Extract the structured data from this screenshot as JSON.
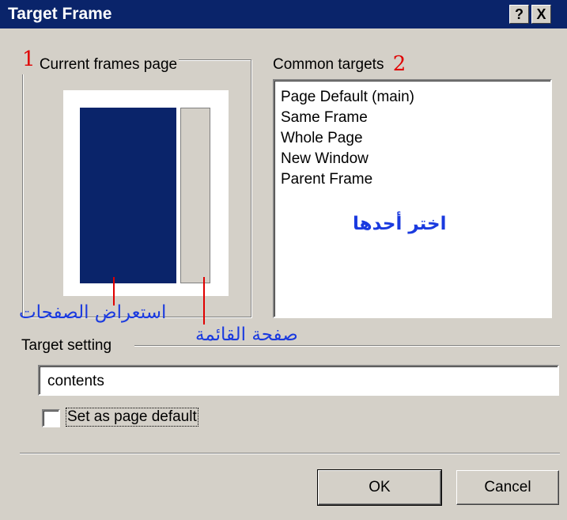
{
  "window": {
    "title": "Target Frame",
    "help_label": "?",
    "close_label": "X"
  },
  "current_frames": {
    "label": "Current frames page",
    "annotation_number": "1"
  },
  "common_targets": {
    "label": "Common targets",
    "annotation_number": "2",
    "items": [
      "Page Default (main)",
      "Same Frame",
      "Whole Page",
      "New Window",
      "Parent Frame"
    ],
    "annotation_text": "اختر أحدها"
  },
  "annotations": {
    "main_frame": "استعراض الصفحات",
    "side_frame": "صفحة القائمة"
  },
  "target_setting": {
    "label": "Target setting",
    "value": "contents"
  },
  "page_default": {
    "label": "Set as page default",
    "checked": false
  },
  "buttons": {
    "ok": "OK",
    "cancel": "Cancel"
  },
  "colors": {
    "titlebar": "#0a246a",
    "main_frame": "#0a246a",
    "side_frame": "#d4d0c8",
    "annotation_red": "#e00000",
    "annotation_blue": "#1a3adf"
  }
}
